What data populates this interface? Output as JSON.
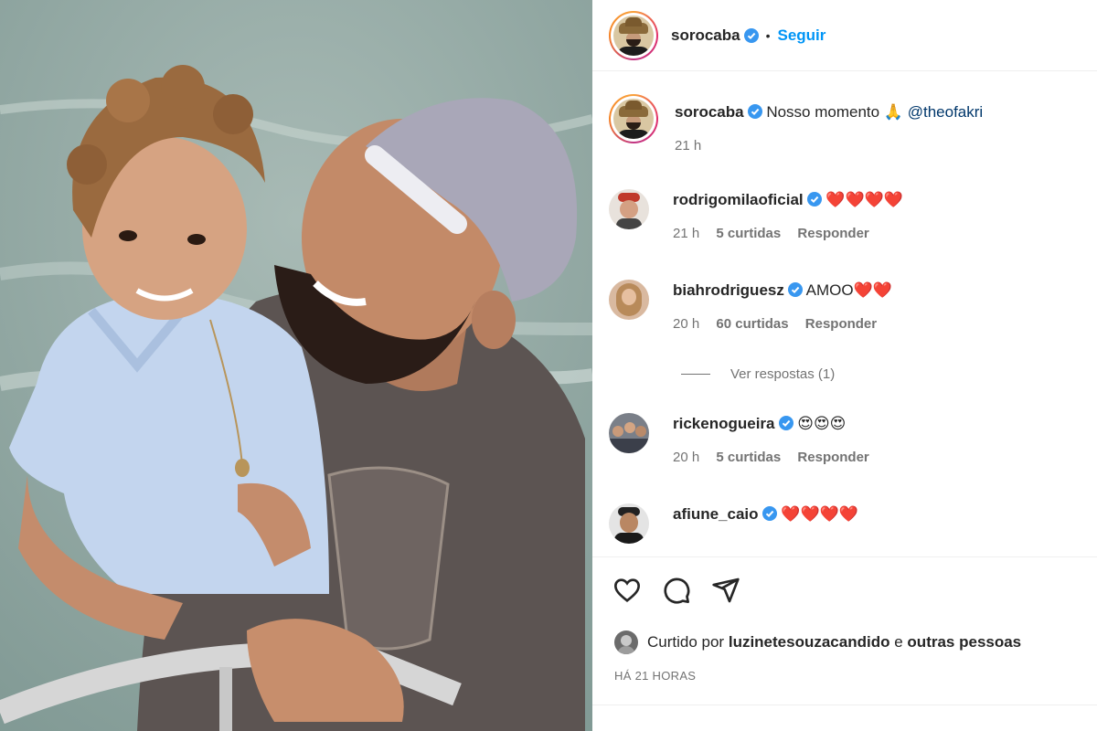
{
  "post": {
    "author": "sorocaba",
    "follow_label": "Seguir",
    "separator": "•",
    "caption": {
      "username": "sorocaba",
      "text": "Nosso momento 🙏",
      "mention": "@theofakri",
      "time": "21 h"
    }
  },
  "comments": [
    {
      "username": "rodrigomilaoficial",
      "text": "❤️❤️❤️❤️",
      "time": "21 h",
      "likes": "5 curtidas",
      "reply": "Responder"
    },
    {
      "username": "biahrodriguesz",
      "text": "AMOO❤️❤️",
      "time": "20 h",
      "likes": "60 curtidas",
      "reply": "Responder"
    },
    {
      "username": "rickenogueira",
      "text": "😍😍😍",
      "time": "20 h",
      "likes": "5 curtidas",
      "reply": "Responder"
    },
    {
      "username": "afiune_caio",
      "text": "❤️❤️❤️❤️"
    }
  ],
  "view_replies": "Ver respostas (1)",
  "liked_by": {
    "prefix": "Curtido por",
    "user": "luzinetesouzacandido",
    "conj": "e",
    "others": "outras pessoas"
  },
  "timestamp": "HÁ 21 HORAS",
  "colors": {
    "accent": "#0095f6",
    "verified": "#3897f0",
    "heart": "#e0245e"
  },
  "icons": [
    "heart-icon",
    "comment-icon",
    "share-icon",
    "verified-icon"
  ]
}
